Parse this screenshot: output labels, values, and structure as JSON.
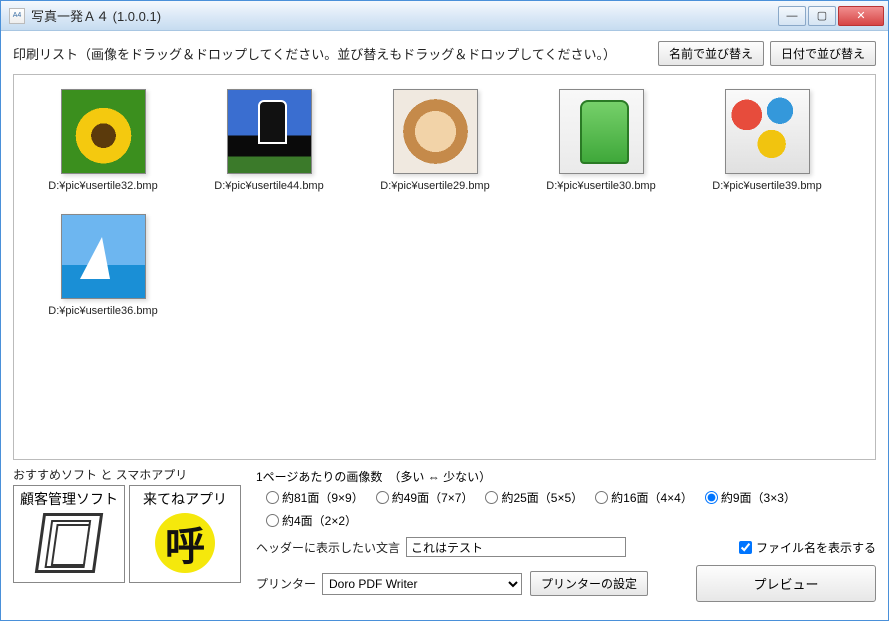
{
  "titlebar": {
    "title": "写真一発Ａ４ (1.0.0.1)"
  },
  "header": {
    "message": "印刷リスト（画像をドラッグ＆ドロップしてください。並び替えもドラッグ＆ドロップしてください。）",
    "sort_name_btn": "名前で並び替え",
    "sort_date_btn": "日付で並び替え"
  },
  "thumbnails": [
    {
      "label": "D:¥pic¥usertile32.bmp"
    },
    {
      "label": "D:¥pic¥usertile44.bmp"
    },
    {
      "label": "D:¥pic¥usertile29.bmp"
    },
    {
      "label": "D:¥pic¥usertile30.bmp"
    },
    {
      "label": "D:¥pic¥usertile39.bmp"
    },
    {
      "label": "D:¥pic¥usertile36.bmp"
    }
  ],
  "recommend": {
    "title": "おすすめソフト と スマホアプリ",
    "items": [
      {
        "label": "顧客管理ソフト"
      },
      {
        "label": "来てねアプリ",
        "char": "呼"
      }
    ]
  },
  "settings": {
    "per_page_label": "1ページあたりの画像数　（多い ⇔ 少ない）",
    "options": [
      "約81面（9×9）",
      "約49面（7×7）",
      "約25面（5×5）",
      "約16面（4×4）",
      "約9面（3×3）",
      "約4面（2×2）"
    ],
    "selected_option": 4,
    "header_text_label": "ヘッダーに表示したい文言",
    "header_text_value": "これはテスト",
    "show_filename_label": "ファイル名を表示する",
    "show_filename_checked": true,
    "printer_label": "プリンター",
    "printer_value": "Doro PDF Writer",
    "printer_settings_btn": "プリンターの設定",
    "preview_btn": "プレビュー"
  }
}
